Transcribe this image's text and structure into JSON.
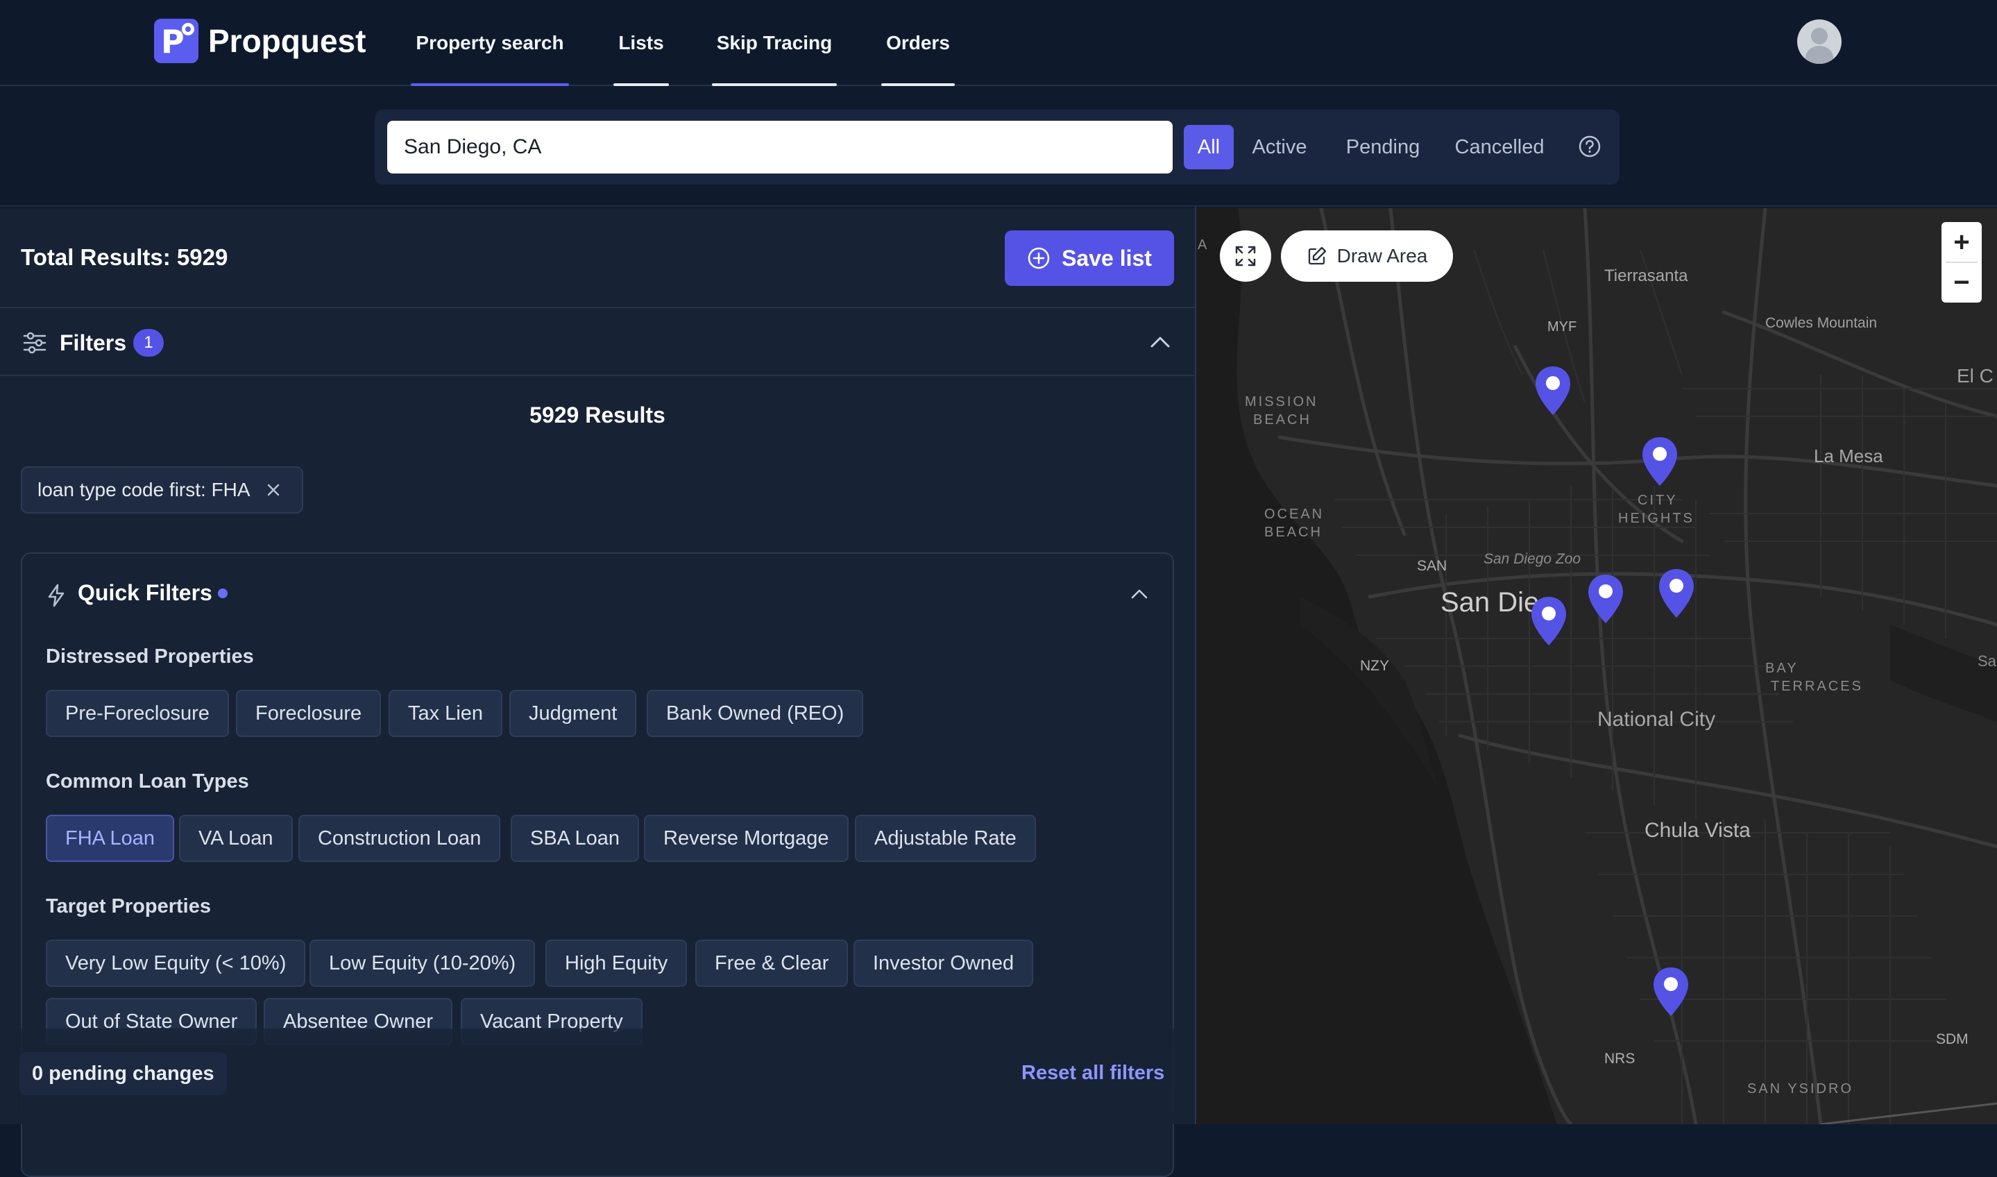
{
  "app": {
    "name": "Propquest",
    "logo_letter": "P"
  },
  "nav": {
    "tabs": [
      {
        "label": "Property search",
        "active": true
      },
      {
        "label": "Lists",
        "active": false
      },
      {
        "label": "Skip Tracing",
        "active": false
      },
      {
        "label": "Orders",
        "active": false
      }
    ]
  },
  "search": {
    "value": "San Diego, CA",
    "statuses": [
      "All",
      "Active",
      "Pending",
      "Cancelled"
    ],
    "active_status": "All"
  },
  "results": {
    "total_label": "Total Results: 5929",
    "save_label": "Save list",
    "count_label": "5929 Results"
  },
  "filters": {
    "label": "Filters",
    "badge": "1",
    "active_chip": "loan type code first: FHA"
  },
  "quick_filters": {
    "title": "Quick Filters",
    "sections": [
      {
        "title": "Distressed Properties",
        "options": [
          "Pre-Foreclosure",
          "Foreclosure",
          "Tax Lien",
          "Judgment",
          "Bank Owned (REO)"
        ]
      },
      {
        "title": "Common Loan Types",
        "options": [
          "FHA Loan",
          "VA Loan",
          "Construction Loan",
          "SBA Loan",
          "Reverse Mortgage",
          "Adjustable Rate"
        ],
        "selected": "FHA Loan"
      },
      {
        "title": "Target Properties",
        "options": [
          "Very Low Equity (< 10%)",
          "Low Equity (10-20%)",
          "High Equity",
          "Free & Clear",
          "Investor Owned",
          "Out of State Owner",
          "Absentee Owner",
          "Vacant Property"
        ]
      }
    ]
  },
  "footer": {
    "pending": "0 pending changes",
    "reset": "Reset all filters"
  },
  "map": {
    "draw_label": "Draw Area",
    "zoom_in": "+",
    "zoom_out": "−",
    "labels": {
      "tierrasanta": "Tierrasanta",
      "myf": "MYF",
      "cowles": "Cowles Mountain",
      "elc": "El C",
      "mission_beach_1": "MISSION",
      "mission_beach_2": "BEACH",
      "ocean_beach_1": "OCEAN",
      "ocean_beach_2": "BEACH",
      "city_heights_1": "CITY",
      "city_heights_2": "HEIGHTS",
      "la_mesa": "La Mesa",
      "san": "SAN",
      "san_diego_zoo": "San Diego Zoo",
      "san_diego": "San Die",
      "nzy": "NZY",
      "bay_terraces_1": "BAY",
      "bay_terraces_2": "TERRACES",
      "national_city": "National City",
      "chula_vista": "Chula Vista",
      "nrs": "NRS",
      "sdm": "SDM",
      "san_ysidro": "SAN YSIDRO",
      "sa": "Sa",
      "a_left": "A"
    }
  },
  "colors": {
    "accent": "#5553e6",
    "background": "#0f1a2d",
    "panel": "#172235",
    "map": "#262626"
  }
}
